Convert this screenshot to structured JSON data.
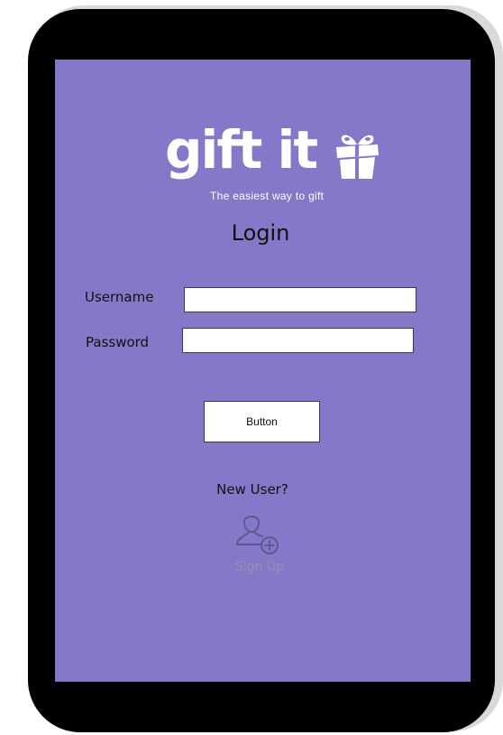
{
  "logo": {
    "wordmark": "gift it",
    "tagline": "The easiest way to gift",
    "icon": "gift-box-icon"
  },
  "login": {
    "title": "Login",
    "username_label": "Username",
    "username_value": "",
    "password_label": "Password",
    "password_value": "",
    "button_label": "Button"
  },
  "signup": {
    "prompt": "New User?",
    "icon": "add-user-icon",
    "label": "Sign Up"
  },
  "colors": {
    "screen_background": "#8379c8",
    "device_frame": "#000000",
    "signup_text": "#958fb4"
  }
}
